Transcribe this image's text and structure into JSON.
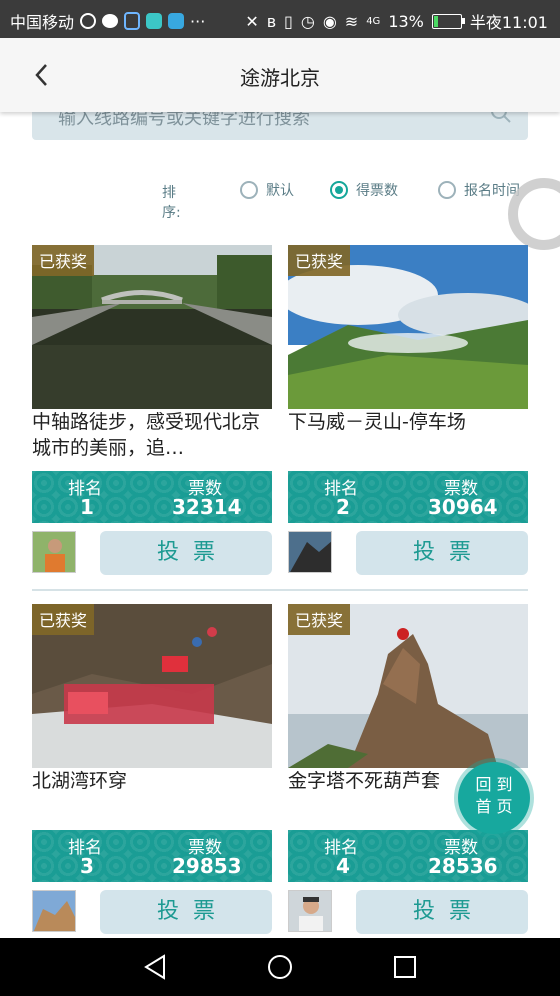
{
  "status_bar": {
    "carrier": "中国移动",
    "dots": "···",
    "network": "4G",
    "battery": "13%",
    "time": "半夜11:01"
  },
  "header": {
    "title": "途游北京"
  },
  "search": {
    "placeholder": "输入线路编号或关键字进行搜索"
  },
  "sort": {
    "label": "排序:",
    "options": [
      {
        "label": "默认",
        "selected": false
      },
      {
        "label": "得票数",
        "selected": true
      },
      {
        "label": "报名时间",
        "selected": false
      }
    ]
  },
  "cards": [
    {
      "badge": "已获奖",
      "name": "中轴路徒步，感受现代北京城市的美丽，追…",
      "rank_label": "排名",
      "rank": "1",
      "votes_label": "票数",
      "votes": "32314",
      "vote_button": "投票"
    },
    {
      "badge": "已获奖",
      "name": "下马威－灵山-停车场",
      "rank_label": "排名",
      "rank": "2",
      "votes_label": "票数",
      "votes": "30964",
      "vote_button": "投票"
    },
    {
      "badge": "已获奖",
      "name": "北湖湾环穿",
      "rank_label": "排名",
      "rank": "3",
      "votes_label": "票数",
      "votes": "29853",
      "vote_button": "投票"
    },
    {
      "badge": "已获奖",
      "name": "金字塔不死葫芦套",
      "rank_label": "排名",
      "rank": "4",
      "votes_label": "票数",
      "votes": "28536",
      "vote_button": "投票"
    }
  ],
  "fab": {
    "line1": "回 到",
    "line2": "首 页"
  },
  "colors": {
    "accent": "#17a89e",
    "badge": "#806728",
    "status_bar": "#3b3b3b"
  }
}
